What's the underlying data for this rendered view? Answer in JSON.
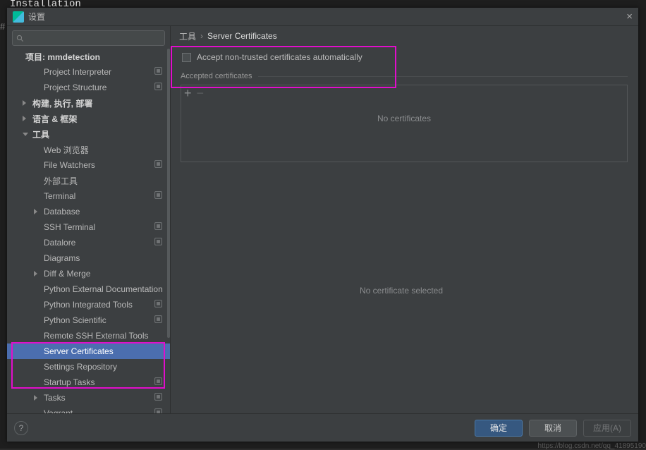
{
  "bg_text": "Installation",
  "dialog": {
    "title": "设置"
  },
  "search": {
    "placeholder": ""
  },
  "projectHeader": "项目: mmdetection",
  "tree": [
    {
      "lvl": 1,
      "label": "Project Interpreter",
      "proj": true
    },
    {
      "lvl": 1,
      "label": "Project Structure",
      "proj": true
    },
    {
      "lvl": 0,
      "label": "构建, 执行, 部署",
      "arrow": "right"
    },
    {
      "lvl": 0,
      "label": "语言 & 框架",
      "arrow": "right"
    },
    {
      "lvl": 0,
      "label": "工具",
      "arrow": "down"
    },
    {
      "lvl": 1,
      "label": "Web 浏览器"
    },
    {
      "lvl": 1,
      "label": "File Watchers",
      "proj": true
    },
    {
      "lvl": 1,
      "label": "外部工具"
    },
    {
      "lvl": 1,
      "label": "Terminal",
      "proj": true
    },
    {
      "lvl": 1,
      "label": "Database",
      "arrow": "right"
    },
    {
      "lvl": 1,
      "label": "SSH Terminal",
      "proj": true
    },
    {
      "lvl": 1,
      "label": "Datalore",
      "proj": true
    },
    {
      "lvl": 1,
      "label": "Diagrams"
    },
    {
      "lvl": 1,
      "label": "Diff & Merge",
      "arrow": "right"
    },
    {
      "lvl": 1,
      "label": "Python External Documentation"
    },
    {
      "lvl": 1,
      "label": "Python Integrated Tools",
      "proj": true
    },
    {
      "lvl": 1,
      "label": "Python Scientific",
      "proj": true
    },
    {
      "lvl": 1,
      "label": "Remote SSH External Tools"
    },
    {
      "lvl": 1,
      "label": "Server Certificates",
      "selected": true
    },
    {
      "lvl": 1,
      "label": "Settings Repository"
    },
    {
      "lvl": 1,
      "label": "Startup Tasks",
      "proj": true
    },
    {
      "lvl": 1,
      "label": "Tasks",
      "arrow": "right",
      "proj": true
    },
    {
      "lvl": 1,
      "label": "Vagrant",
      "proj": true
    }
  ],
  "breadcrumb": {
    "root": "工具",
    "current": "Server Certificates"
  },
  "checkbox_label": "Accept non-trusted certificates automatically",
  "accepted_label": "Accepted certificates",
  "no_certificates": "No certificates",
  "no_selected": "No certificate selected",
  "buttons": {
    "ok": "确定",
    "cancel": "取消",
    "apply": "应用(A)"
  },
  "watermark": "https://blog.csdn.net/qq_41895190"
}
